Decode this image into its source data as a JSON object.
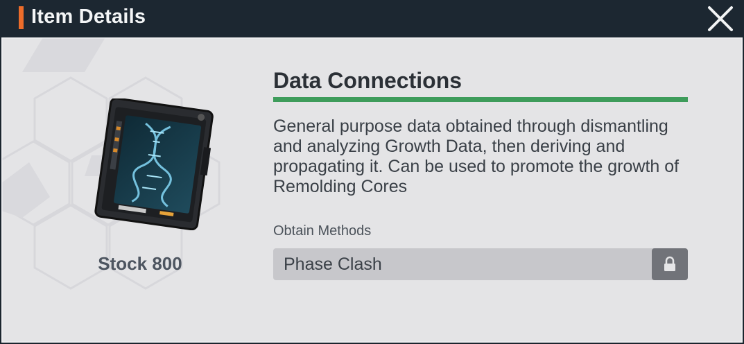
{
  "dialog": {
    "title": "Item Details",
    "accent_color": "#ec6c2a"
  },
  "item": {
    "name": "Data Connections",
    "name_underline_color": "#3e9c5b",
    "description": "General purpose data obtained through dismantling and analyzing Growth Data, then deriving and propagating it. Can be used to promote the growth of Remolding Cores",
    "stock_label": "Stock",
    "stock_count": "800"
  },
  "obtain": {
    "label": "Obtain Methods",
    "methods": [
      {
        "name": "Phase Clash",
        "locked": true
      }
    ]
  },
  "icons": {
    "close": "close-icon",
    "lock": "lock-icon",
    "item": "data-tablet-dna-icon"
  }
}
